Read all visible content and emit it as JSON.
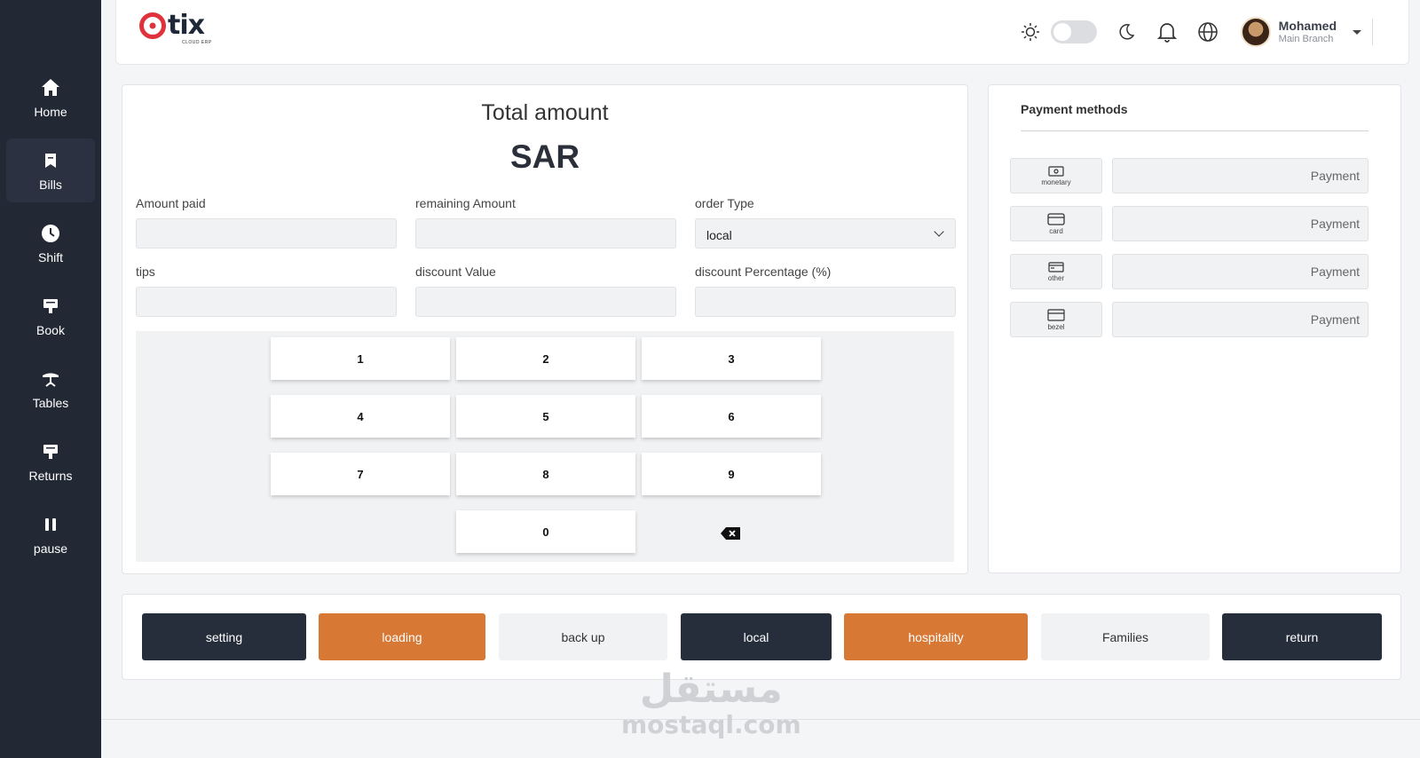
{
  "sidebar": {
    "items": [
      {
        "label": "Home",
        "icon": "home-icon"
      },
      {
        "label": "Bills",
        "icon": "bookmark-icon",
        "active": true
      },
      {
        "label": "Shift",
        "icon": "clock-icon"
      },
      {
        "label": "Book",
        "icon": "book-icon"
      },
      {
        "label": "Tables",
        "icon": "table-icon"
      },
      {
        "label": "Returns",
        "icon": "returns-icon"
      },
      {
        "label": "pause",
        "icon": "pause-icon"
      }
    ]
  },
  "header": {
    "logo_text": "tix",
    "logo_sub": "CLOUD ERP",
    "user_name": "Mohamed",
    "user_branch": "Main Branch"
  },
  "main": {
    "total_title": "Total amount",
    "total_value": "SAR",
    "fields": {
      "amount_paid": "Amount paid",
      "remaining_amount": "remaining Amount",
      "order_type": "order Type",
      "order_type_value": "local",
      "tips": "tips",
      "discount_value": "discount Value",
      "discount_percentage": "discount Percentage (%)"
    },
    "keys": [
      "1",
      "2",
      "3",
      "4",
      "5",
      "6",
      "7",
      "8",
      "9",
      "0"
    ]
  },
  "payment": {
    "title": "Payment methods",
    "methods": [
      {
        "label": "monetary",
        "placeholder": "Payment",
        "icon": "cash-icon"
      },
      {
        "label": "card",
        "placeholder": "Payment",
        "icon": "card-icon"
      },
      {
        "label": "other",
        "placeholder": "Payment",
        "icon": "other-payment-icon"
      },
      {
        "label": "bezel",
        "placeholder": "Payment",
        "icon": "bezel-icon"
      }
    ]
  },
  "bottom_bar": {
    "buttons": [
      {
        "label": "setting",
        "style": "dark"
      },
      {
        "label": "loading",
        "style": "orange"
      },
      {
        "label": "back up",
        "style": "light"
      },
      {
        "label": "local",
        "style": "dark"
      },
      {
        "label": "hospitality",
        "style": "orange"
      },
      {
        "label": "Families",
        "style": "light"
      },
      {
        "label": "return",
        "style": "dark"
      }
    ]
  },
  "colors": {
    "sidebar_bg": "#222834",
    "dark_button": "#272e3b",
    "orange_button": "#d77834",
    "logo_red": "#e0323c"
  },
  "watermark": {
    "arabic": "مستقل",
    "latin": "mostaql.com"
  }
}
